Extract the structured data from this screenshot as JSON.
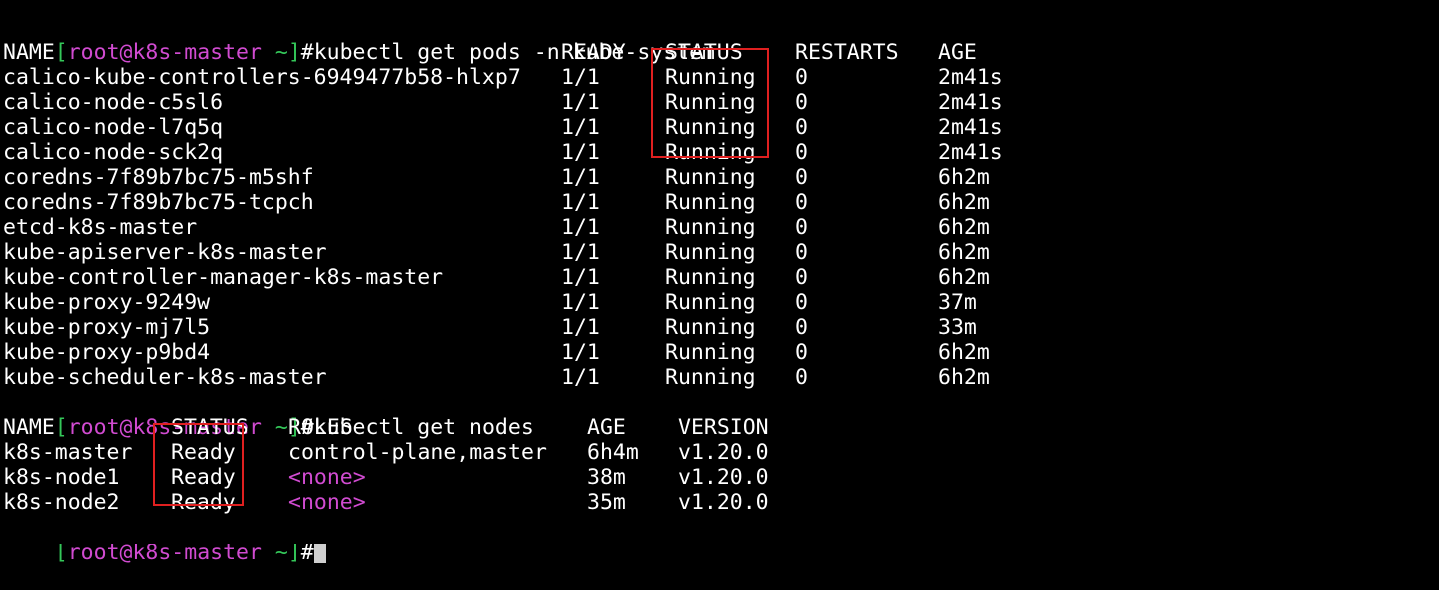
{
  "colors": {
    "background": "#000000",
    "text": "#ffffff",
    "prompt_bracket": "#34c759",
    "prompt_user_host": "#d14bd1",
    "highlight_border": "#e02020",
    "cursor": "#cfcfcf"
  },
  "prompt": {
    "open": "[",
    "user": "root",
    "at": "@",
    "host": "k8s-master",
    "cwd": " ~",
    "close": "]",
    "sign": "#"
  },
  "commands": {
    "pods": "kubectl get pods -n kube-system",
    "nodes": "kubectl get nodes"
  },
  "pods": {
    "headers": {
      "name": "NAME",
      "ready": "READY",
      "status": "STATUS",
      "restarts": "RESTARTS",
      "age": "AGE"
    },
    "rows": [
      {
        "name": "calico-kube-controllers-6949477b58-hlxp7",
        "ready": "1/1",
        "status": "Running",
        "restarts": "0",
        "age": "2m41s"
      },
      {
        "name": "calico-node-c5sl6",
        "ready": "1/1",
        "status": "Running",
        "restarts": "0",
        "age": "2m41s"
      },
      {
        "name": "calico-node-l7q5q",
        "ready": "1/1",
        "status": "Running",
        "restarts": "0",
        "age": "2m41s"
      },
      {
        "name": "calico-node-sck2q",
        "ready": "1/1",
        "status": "Running",
        "restarts": "0",
        "age": "2m41s"
      },
      {
        "name": "coredns-7f89b7bc75-m5shf",
        "ready": "1/1",
        "status": "Running",
        "restarts": "0",
        "age": "6h2m"
      },
      {
        "name": "coredns-7f89b7bc75-tcpch",
        "ready": "1/1",
        "status": "Running",
        "restarts": "0",
        "age": "6h2m"
      },
      {
        "name": "etcd-k8s-master",
        "ready": "1/1",
        "status": "Running",
        "restarts": "0",
        "age": "6h2m"
      },
      {
        "name": "kube-apiserver-k8s-master",
        "ready": "1/1",
        "status": "Running",
        "restarts": "0",
        "age": "6h2m"
      },
      {
        "name": "kube-controller-manager-k8s-master",
        "ready": "1/1",
        "status": "Running",
        "restarts": "0",
        "age": "6h2m"
      },
      {
        "name": "kube-proxy-9249w",
        "ready": "1/1",
        "status": "Running",
        "restarts": "0",
        "age": "37m"
      },
      {
        "name": "kube-proxy-mj7l5",
        "ready": "1/1",
        "status": "Running",
        "restarts": "0",
        "age": "33m"
      },
      {
        "name": "kube-proxy-p9bd4",
        "ready": "1/1",
        "status": "Running",
        "restarts": "0",
        "age": "6h2m"
      },
      {
        "name": "kube-scheduler-k8s-master",
        "ready": "1/1",
        "status": "Running",
        "restarts": "0",
        "age": "6h2m"
      }
    ]
  },
  "nodes": {
    "headers": {
      "name": "NAME",
      "status": "STATUS",
      "roles": "ROLES",
      "age": "AGE",
      "version": "VERSION"
    },
    "rows": [
      {
        "name": "k8s-master",
        "status": "Ready",
        "roles": "control-plane,master",
        "age": "6h4m",
        "version": "v1.20.0"
      },
      {
        "name": "k8s-node1",
        "status": "Ready",
        "roles": "<none>",
        "age": "38m",
        "version": "v1.20.0"
      },
      {
        "name": "k8s-node2",
        "status": "Ready",
        "roles": "<none>",
        "age": "35m",
        "version": "v1.20.0"
      }
    ]
  }
}
